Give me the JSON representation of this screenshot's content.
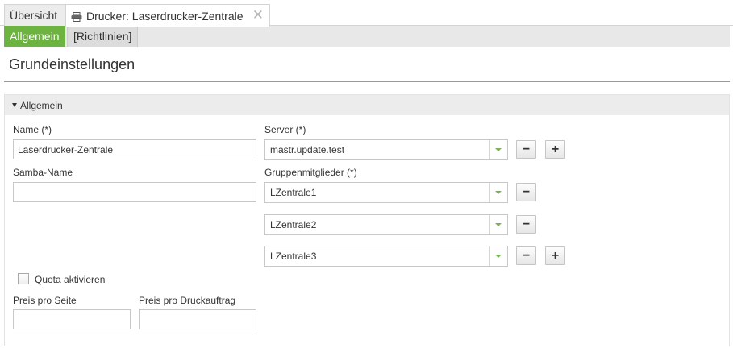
{
  "tabs": {
    "overview_label": "Übersicht",
    "printer_label": "Drucker: Laserdrucker-Zentrale"
  },
  "subtabs": {
    "general_label": "Allgemein",
    "rules_label": "[Richtlinien]"
  },
  "page": {
    "title": "Grundeinstellungen"
  },
  "section": {
    "title": "Allgemein",
    "name_label": "Name (*)",
    "name_value": "Laserdrucker-Zentrale",
    "samba_label": "Samba-Name",
    "samba_value": "",
    "server_label": "Server (*)",
    "server_value": "mastr.update.test",
    "members_label": "Gruppenmitglieder (*)",
    "members": [
      "LZentrale1",
      "LZentrale2",
      "LZentrale3"
    ],
    "quota_label": "Quota aktivieren",
    "price_page_label": "Preis pro Seite",
    "price_page_value": "",
    "price_job_label": "Preis pro Druckauftrag",
    "price_job_value": ""
  },
  "icons": {
    "remove": "−",
    "add": "+",
    "close": "✕"
  },
  "colors": {
    "accent": "#6cb33f"
  }
}
